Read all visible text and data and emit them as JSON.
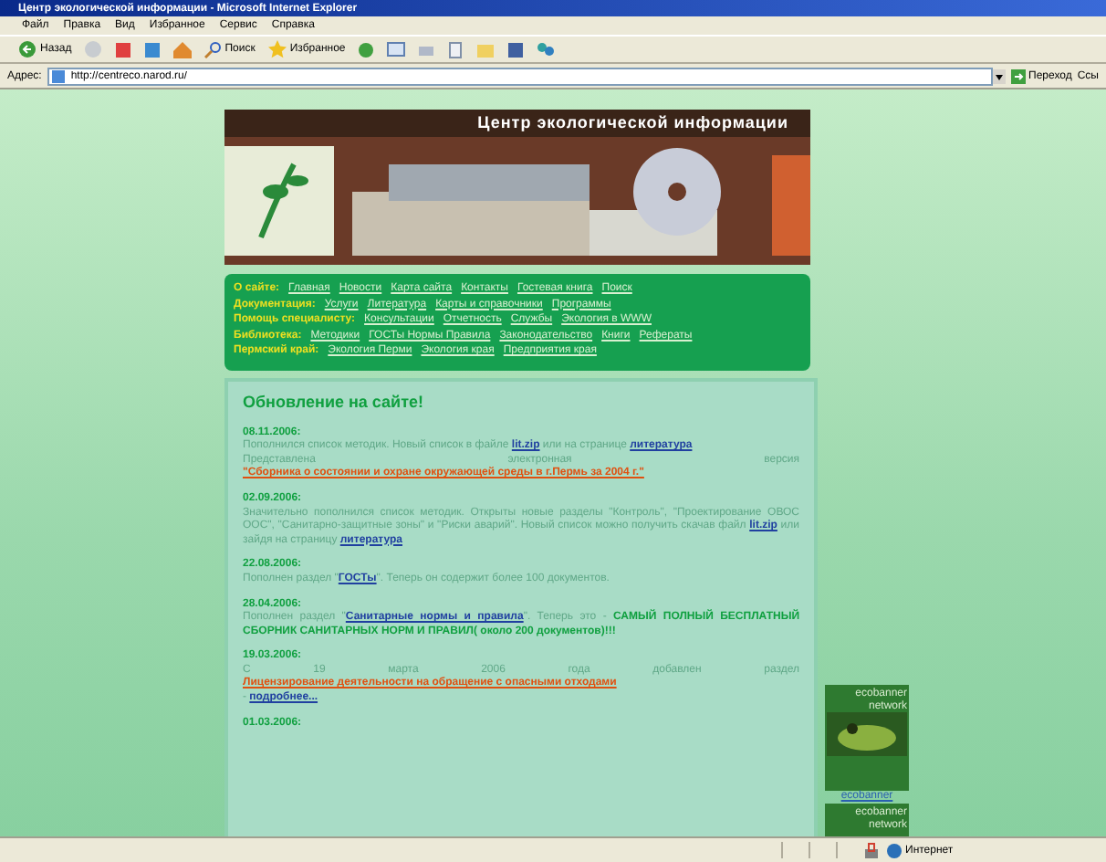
{
  "window": {
    "title": "Центр экологической информации - Microsoft Internet Explorer"
  },
  "menu": [
    "Файл",
    "Правка",
    "Вид",
    "Избранное",
    "Сервис",
    "Справка"
  ],
  "toolbar": [
    {
      "kind": "back",
      "label": "Назад"
    },
    {
      "kind": "forward"
    },
    {
      "kind": "stop"
    },
    {
      "kind": "refresh"
    },
    {
      "kind": "home"
    },
    {
      "kind": "search",
      "label": "Поиск"
    },
    {
      "kind": "favorites",
      "label": "Избранное"
    },
    {
      "kind": "history"
    },
    {
      "kind": "mail"
    },
    {
      "kind": "print"
    },
    {
      "kind": "edit"
    },
    {
      "kind": "folder"
    },
    {
      "kind": "media"
    },
    {
      "kind": "messenger"
    }
  ],
  "address": {
    "label": "Адрес:",
    "value": "http://centreco.narod.ru/",
    "go": "Переход",
    "links": "Ссы"
  },
  "site": {
    "title": "Центр экологической информации",
    "nav": [
      {
        "label": "О сайте:",
        "links": [
          "Главная",
          "Новости",
          "Карта сайта",
          "Контакты",
          "Гостевая книга",
          "Поиск"
        ]
      },
      {
        "label": "Документация:",
        "links": [
          "Услуги",
          "Литература",
          "Карты и справочники",
          "Программы"
        ]
      },
      {
        "label": "Помощь специалисту:",
        "links": [
          "Консультации",
          "Отчетность",
          "Службы",
          "Экология в WWW"
        ]
      },
      {
        "label": "Библиотека:",
        "links": [
          "Методики",
          "ГОСТы Нормы Правила",
          "Законодательство",
          "Книги",
          "Рефераты"
        ]
      },
      {
        "label": "Пермский край:",
        "links": [
          "Экология Перми",
          "Экология края",
          "Предприятия края"
        ]
      }
    ],
    "heading": "Обновление на сайте!",
    "news": [
      {
        "date": "08.11.2006:",
        "paragraphs": [
          [
            {
              "kind": "text",
              "text": "Пополнился список методик. Новый список в файле "
            },
            {
              "kind": "link",
              "text": "lit.zip"
            },
            {
              "kind": "text",
              "text": " или на странице "
            },
            {
              "kind": "link",
              "text": "литература"
            }
          ],
          [
            {
              "kind": "text",
              "text": "Представлена электронная версия "
            },
            {
              "kind": "accent-link",
              "text": "\"Сборника о состоянии и охране окружающей среды в г.Пермь за 2004 г.\""
            }
          ]
        ]
      },
      {
        "date": "02.09.2006:",
        "paragraphs": [
          [
            {
              "kind": "text",
              "text": "Значительно пополнился список методик. Открыты новые разделы \"Контроль\", \"Проектирование ОВОС ООС\", \"Санитарно-защитные зоны\" и \"Риски аварий\". Новый список можно получить скачав файл "
            },
            {
              "kind": "link",
              "text": "lit.zip"
            },
            {
              "kind": "text",
              "text": " или зайдя на страницу "
            },
            {
              "kind": "link",
              "text": "литература"
            }
          ]
        ]
      },
      {
        "date": "22.08.2006:",
        "paragraphs": [
          [
            {
              "kind": "text",
              "text": "Пополнен раздел \""
            },
            {
              "kind": "link",
              "text": "ГОСТы"
            },
            {
              "kind": "text",
              "text": "\". Теперь он содержит более 100 документов."
            }
          ]
        ]
      },
      {
        "date": "28.04.2006:",
        "paragraphs": [
          [
            {
              "kind": "text",
              "text": "Пополнен раздел \""
            },
            {
              "kind": "link",
              "text": "Санитарные нормы и правила"
            },
            {
              "kind": "text",
              "text": "\". Теперь это - "
            },
            {
              "kind": "bold",
              "text": "САМЫЙ ПОЛНЫЙ БЕСПЛАТНЫЙ СБОРНИК САНИТАРНЫХ НОРМ И ПРАВИЛ( около 200 документов)!!!"
            }
          ]
        ]
      },
      {
        "date": "19.03.2006:",
        "paragraphs": [
          [
            {
              "kind": "text",
              "text": "С 19 марта 2006 года добавлен раздел "
            },
            {
              "kind": "accent-link",
              "text": "Лицензирование деятельности на обращение с опасными отходами"
            }
          ],
          [
            {
              "kind": "text",
              "text": "- "
            },
            {
              "kind": "link",
              "text": "подробнее..."
            }
          ]
        ]
      },
      {
        "date": "01.03.2006:"
      }
    ],
    "banners": [
      {
        "kind": "image",
        "text": "ecobanner network",
        "caption": "ecobanner"
      },
      {
        "kind": "plain",
        "text": "ecobanner network"
      }
    ]
  },
  "status_bar": {
    "zone": "Интернет"
  }
}
